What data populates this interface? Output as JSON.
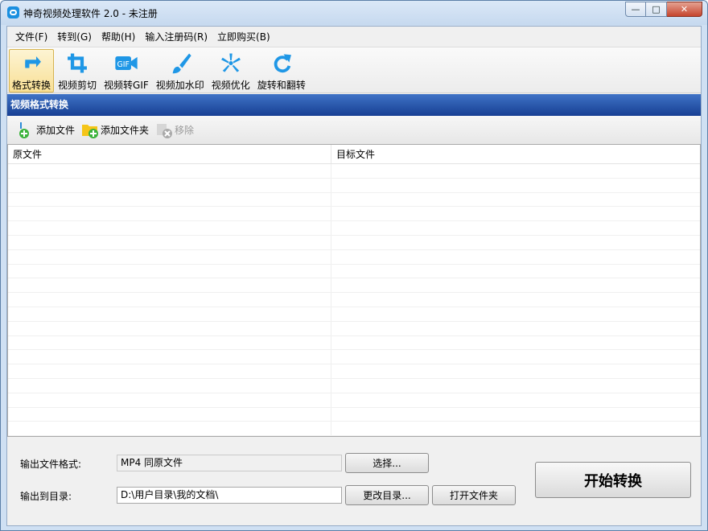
{
  "window": {
    "title": "神奇视频处理软件 2.0 - 未注册"
  },
  "menu": [
    "文件(F)",
    "转到(G)",
    "帮助(H)",
    "输入注册码(R)",
    "立即购买(B)"
  ],
  "toolbar": [
    {
      "label": "格式转换",
      "icon": "format-convert-icon",
      "active": true
    },
    {
      "label": "视频剪切",
      "icon": "crop-icon"
    },
    {
      "label": "视频转GIF",
      "icon": "gif-icon"
    },
    {
      "label": "视频加水印",
      "icon": "brush-icon"
    },
    {
      "label": "视频优化",
      "icon": "optimize-icon"
    },
    {
      "label": "旋转和翻转",
      "icon": "rotate-icon"
    }
  ],
  "section_title": "视频格式转换",
  "file_actions": {
    "add_file": "添加文件",
    "add_folder": "添加文件夹",
    "remove": "移除"
  },
  "table": {
    "columns": [
      "原文件",
      "目标文件"
    ],
    "rows": []
  },
  "output": {
    "format_label": "输出文件格式:",
    "format_value": "MP4 同原文件",
    "select_button": "选择...",
    "dir_label": "输出到目录:",
    "dir_value": "D:\\用户目录\\我的文档\\",
    "change_dir_button": "更改目录...",
    "open_folder_button": "打开文件夹",
    "start_button": "开始转换"
  },
  "colors": {
    "accent": "#1f97e6",
    "section_bar": "#1f4ea3"
  }
}
